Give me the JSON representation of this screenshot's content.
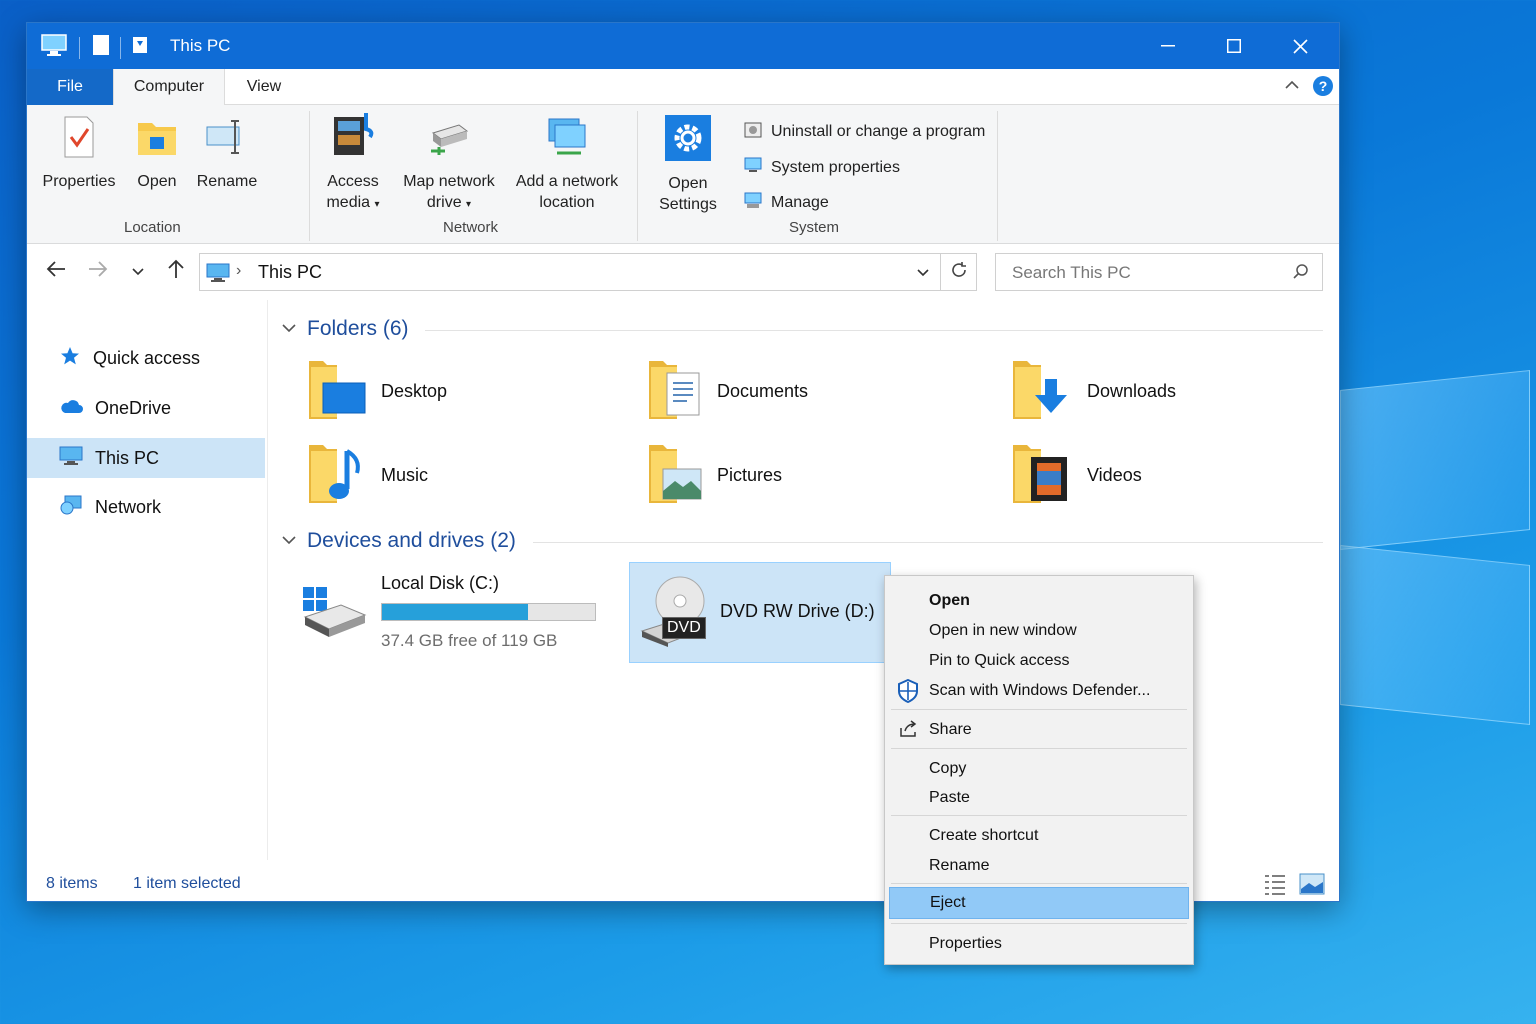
{
  "window": {
    "title": "This PC",
    "controls": {
      "minimize": "—",
      "maximize": "☐",
      "close": "✕"
    }
  },
  "tabs": {
    "file": "File",
    "computer": "Computer",
    "view": "View"
  },
  "ribbon": {
    "location": {
      "label": "Location",
      "properties": "Properties",
      "open": "Open",
      "rename": "Rename"
    },
    "network": {
      "label": "Network",
      "access_media": [
        "Access",
        "media"
      ],
      "map_drive": [
        "Map network",
        "drive"
      ],
      "add_location": [
        "Add a network",
        "location"
      ]
    },
    "system": {
      "label": "System",
      "open_settings": [
        "Open",
        "Settings"
      ],
      "uninstall": "Uninstall or change a program",
      "sys_props": "System properties",
      "manage": "Manage"
    }
  },
  "address": {
    "path": "This PC",
    "search_placeholder": "Search This PC"
  },
  "sidebar": {
    "items": [
      {
        "label": "Quick access"
      },
      {
        "label": "OneDrive"
      },
      {
        "label": "This PC"
      },
      {
        "label": "Network"
      }
    ]
  },
  "content": {
    "folders_header": "Folders (6)",
    "folders": [
      {
        "name": "Desktop"
      },
      {
        "name": "Documents"
      },
      {
        "name": "Downloads"
      },
      {
        "name": "Music"
      },
      {
        "name": "Pictures"
      },
      {
        "name": "Videos"
      }
    ],
    "drives_header": "Devices and drives (2)",
    "drives": {
      "c": {
        "name": "Local Disk (C:)",
        "free": "37.4 GB free of 119 GB",
        "used_fraction": 0.686
      },
      "d": {
        "name": "DVD RW Drive (D:)",
        "badge": "DVD"
      }
    }
  },
  "status": {
    "items": "8 items",
    "selected": "1 item selected"
  },
  "context_menu": {
    "open": "Open",
    "open_new": "Open in new window",
    "pin": "Pin to Quick access",
    "scan": "Scan with Windows Defender...",
    "share": "Share",
    "copy": "Copy",
    "paste": "Paste",
    "shortcut": "Create shortcut",
    "rename": "Rename",
    "eject": "Eject",
    "properties": "Properties"
  },
  "colors": {
    "accent": "#0f6cd6",
    "selection": "#cce4f7",
    "highlight": "#91c9f7"
  }
}
